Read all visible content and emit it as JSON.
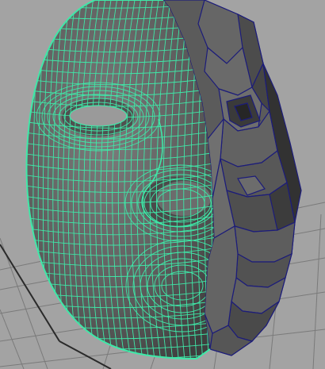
{
  "viewport": {
    "background_color": "#a3a3a3",
    "grid_color": "#7a7a7a"
  },
  "model": {
    "wireframe_color": "#3fe8a8",
    "shell_edge_color": "#1c1c7a",
    "shell_fill_color": "#5a5a5a",
    "face_fill_color": "#6a6a6a"
  }
}
